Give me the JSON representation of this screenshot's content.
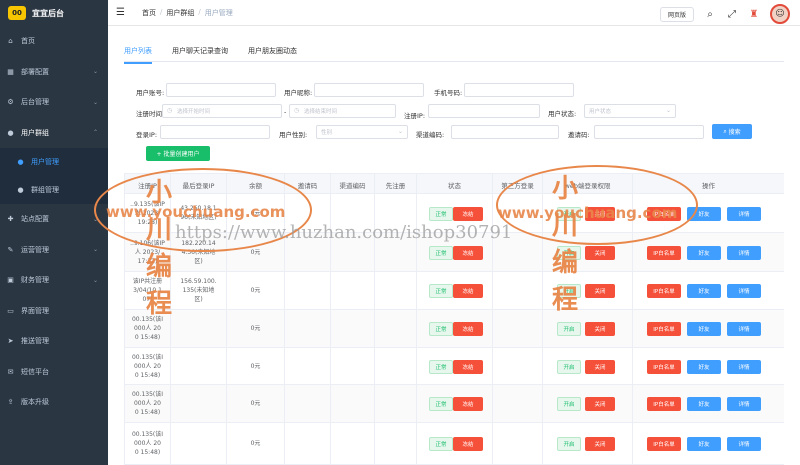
{
  "app": {
    "logo_badge": "00",
    "title": "宜宜后台"
  },
  "sidebar": {
    "items": [
      {
        "label": "首页",
        "icon": "home-icon"
      },
      {
        "label": "部署配置",
        "icon": "grid-icon"
      },
      {
        "label": "后台管理",
        "icon": "gear-icon"
      },
      {
        "label": "用户群组",
        "icon": "user-icon"
      },
      {
        "label": "用户管理",
        "icon": "user-icon"
      },
      {
        "label": "群组管理",
        "icon": "users-icon"
      },
      {
        "label": "站点配置",
        "icon": "puzzle-icon"
      },
      {
        "label": "运营管理",
        "icon": "wrench-icon"
      },
      {
        "label": "财务管理",
        "icon": "wallet-icon"
      },
      {
        "label": "界面管理",
        "icon": "monitor-icon"
      },
      {
        "label": "推送管理",
        "icon": "send-icon"
      },
      {
        "label": "短信平台",
        "icon": "chat-icon"
      },
      {
        "label": "版本升级",
        "icon": "upgrade-icon"
      }
    ]
  },
  "header": {
    "breadcrumb": [
      "首页",
      "用户群组",
      "用户管理"
    ],
    "web_button": "网页版"
  },
  "tabs": [
    "用户列表",
    "用户聊天记录查询",
    "用户朋友圈动态"
  ],
  "filters": {
    "account_label": "用户账号:",
    "nickname_label": "用户昵称:",
    "phone_label": "手机号码:",
    "regtime_label": "注册时间:",
    "start_placeholder": "选择开始时间",
    "range_sep": "-",
    "end_placeholder": "选择结束时间",
    "regip_label": "注册IP:",
    "status_label": "用户状态:",
    "status_placeholder": "用户状态",
    "loginip_label": "登录IP:",
    "gender_label": "用户性别:",
    "gender_placeholder": "性别",
    "invite_label": "渠道编码:",
    "invitecode_label": "邀请码:",
    "search_button": "搜索",
    "batch_button": "+ 批量创建用户"
  },
  "table": {
    "headers": [
      "注册IP",
      "最后登录IP",
      "余额",
      "邀请码",
      "渠道编码",
      "先注册",
      "状态",
      "第三方登录",
      "web端登录权限",
      "操作"
    ],
    "rows": [
      {
        "reg": "..9.135(该IP\n人 2023/\n19:28)",
        "last": "43.250.18.1\n96(未知地区)",
        "bal": "0元",
        "s1": "正常",
        "s2": "冻结",
        "w1": "开启",
        "w2": "关闭"
      },
      {
        "reg": "..9.106(该IP\n人 2023/\n17:32)",
        "last": "182.220.14\n4.36(未知地\n区)",
        "bal": "0元",
        "s1": "正常",
        "s2": "冻结",
        "w1": "开启",
        "w2": "关闭"
      },
      {
        "reg": "该IP共注册\n3/04/10 1\n07)",
        "last": "156.59.100.\n135(未知地\n区)",
        "bal": "0元",
        "s1": "正常",
        "s2": "冻结",
        "w1": "开启",
        "w2": "关闭"
      },
      {
        "reg": "00.135(该I\n000人 20\n0 15:48)",
        "last": "",
        "bal": "0元",
        "s1": "正常",
        "s2": "冻结",
        "w1": "开启",
        "w2": "关闭"
      },
      {
        "reg": "00.135(该I\n000人 20\n0 15:48)",
        "last": "",
        "bal": "0元",
        "s1": "正常",
        "s2": "冻结",
        "w1": "开启",
        "w2": "关闭"
      },
      {
        "reg": "00.135(该I\n000人 20\n0 15:48)",
        "last": "",
        "bal": "0元",
        "s1": "正常",
        "s2": "冻结",
        "w1": "开启",
        "w2": "关闭"
      },
      {
        "reg": "00.135(该I\n000人 20\n0 15:48)",
        "last": "",
        "bal": "0元",
        "s1": "正常",
        "s2": "冻结",
        "w1": "开启",
        "w2": "关闭"
      }
    ],
    "ops": {
      "ip_whitelist": "IP白名单",
      "friends": "好友",
      "detail": "详情"
    }
  },
  "watermark": {
    "cn": "小川编程",
    "url": "www.youchuang.com",
    "center": "https://www.huzhan.com/ishop30791"
  }
}
